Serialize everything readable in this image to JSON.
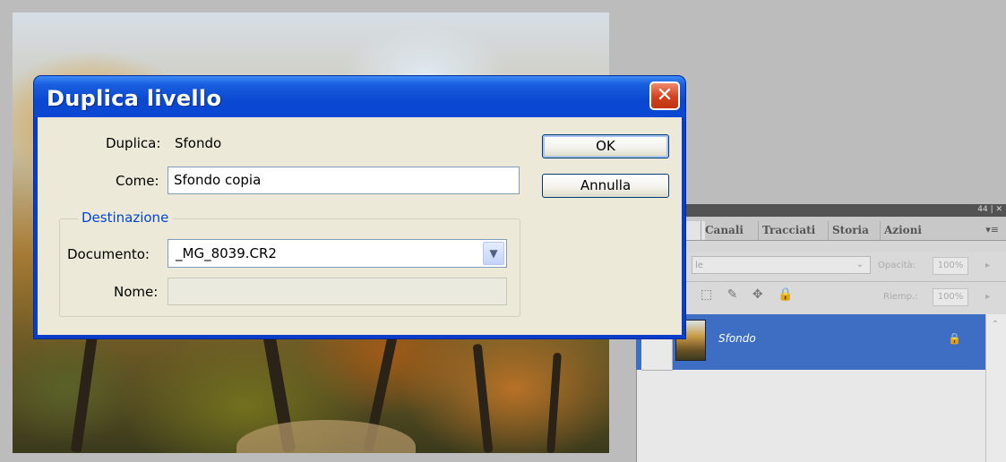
{
  "dialog": {
    "title": "Duplica livello",
    "close_glyph": "✕",
    "duplicate_label": "Duplica:",
    "duplicate_value": "Sfondo",
    "as_label": "Come:",
    "as_value": "Sfondo copia",
    "ok_label": "OK",
    "cancel_label": "Annulla",
    "destination_legend": "Destinazione",
    "document_label": "Documento:",
    "document_value": "_MG_8039.CR2",
    "name_label": "Nome:",
    "name_value": ""
  },
  "layers_panel": {
    "controls": "44 | ✕",
    "tabs": [
      "",
      "Canali",
      "Tracciati",
      "Storia",
      "Azioni"
    ],
    "menu_glyph": "▾≡",
    "blend_mode": "le",
    "opacity_label": "Opacità:",
    "opacity_value": "100%",
    "fill_label": "Riemp.:",
    "fill_value": "100%",
    "lock_icons": "⬚ ✎ ✥ 🔒",
    "layer": {
      "name": "Sfondo",
      "lock_glyph": "🔒"
    }
  },
  "colors": {
    "title_bar": "#0a48d0",
    "close_button": "#d2411f",
    "selected_layer": "#3e6ec3",
    "group_legend": "#0046d5"
  }
}
